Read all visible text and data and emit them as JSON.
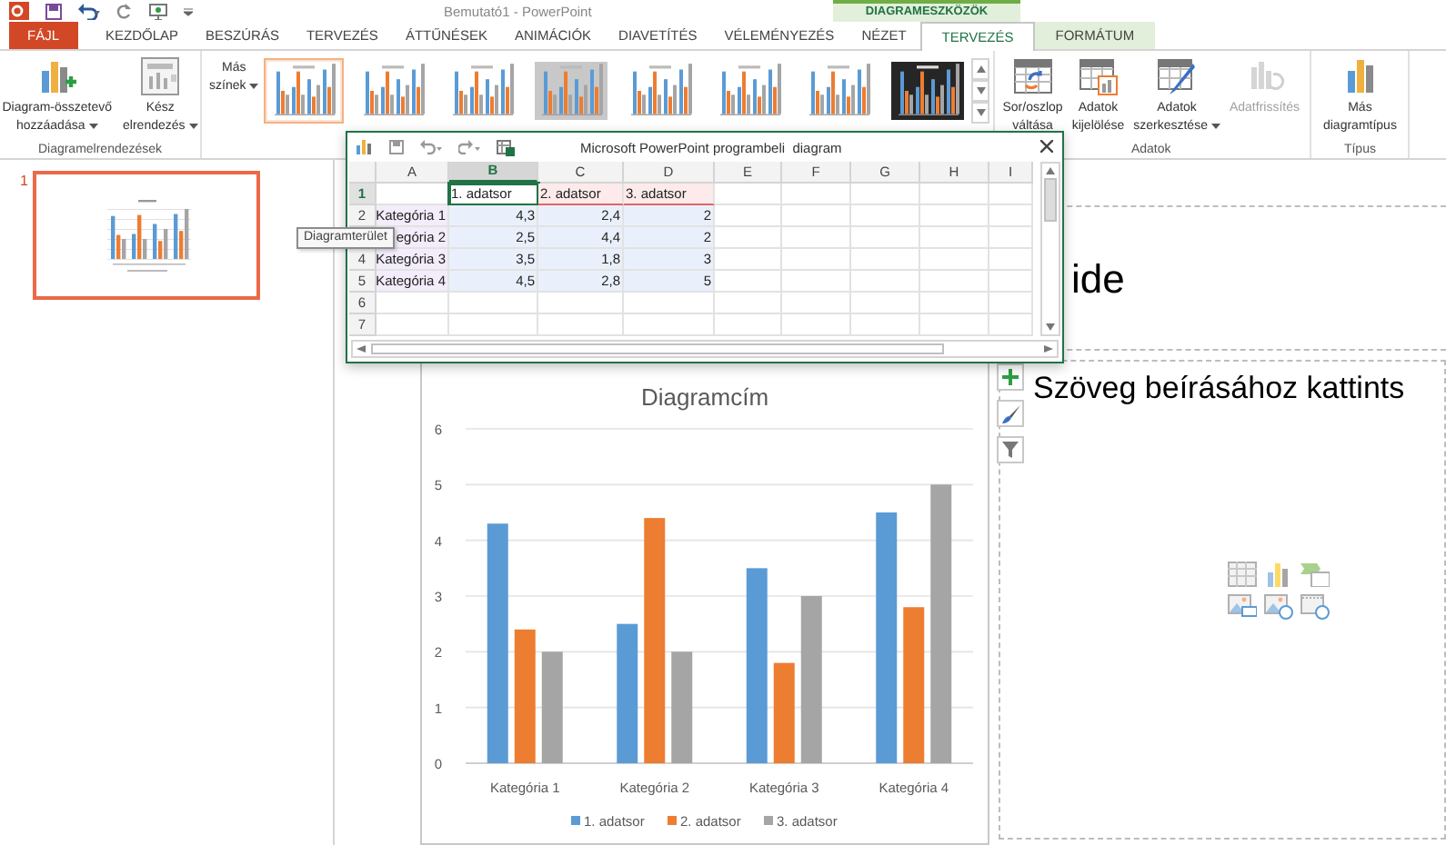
{
  "window": {
    "title": "Bemutató1 - PowerPoint"
  },
  "contextual_group": "DIAGRAMESZKÖZÖK",
  "tabs": [
    {
      "label": "FÁJL",
      "kind": "file",
      "selected": false
    },
    {
      "label": "KEZDŐLAP",
      "kind": "normal",
      "selected": false
    },
    {
      "label": "BESZÚRÁS",
      "kind": "normal",
      "selected": false
    },
    {
      "label": "TERVEZÉS",
      "kind": "normal",
      "selected": false
    },
    {
      "label": "ÁTTŰNÉSEK",
      "kind": "normal",
      "selected": false
    },
    {
      "label": "ANIMÁCIÓK",
      "kind": "normal",
      "selected": false
    },
    {
      "label": "DIAVETÍTÉS",
      "kind": "normal",
      "selected": false
    },
    {
      "label": "VÉLEMÉNYEZÉS",
      "kind": "normal",
      "selected": false
    },
    {
      "label": "NÉZET",
      "kind": "normal",
      "selected": false
    },
    {
      "label": "TERVEZÉS",
      "kind": "contextual",
      "selected": true
    },
    {
      "label": "FORMÁTUM",
      "kind": "contextual",
      "selected": false
    }
  ],
  "layouts_group": {
    "label": "Diagramelrendezések",
    "buttons": [
      {
        "kind": "add",
        "lines": [
          "Diagram-összetevő",
          "hozzáadása"
        ],
        "dropdown": true
      },
      {
        "kind": "layout",
        "lines": [
          "Kész",
          "elrendezés"
        ],
        "dropdown": true
      }
    ]
  },
  "colors_button": {
    "lines": [
      "Más",
      "színek"
    ],
    "dropdown": true
  },
  "chart_styles": [
    {
      "kind": "light",
      "selected": true
    },
    {
      "kind": "light",
      "selected": false
    },
    {
      "kind": "light",
      "selected": false
    },
    {
      "kind": "gray",
      "selected": false
    },
    {
      "kind": "light",
      "selected": false
    },
    {
      "kind": "light",
      "selected": false
    },
    {
      "kind": "light",
      "selected": false
    },
    {
      "kind": "dark",
      "selected": false
    }
  ],
  "data_group": {
    "label": "Adatok",
    "buttons": [
      {
        "kind": "switch",
        "lines": [
          "Sor/oszlop",
          "váltása"
        ],
        "dropdown": false,
        "disabled": false
      },
      {
        "kind": "select",
        "lines": [
          "Adatok",
          "kijelölése"
        ],
        "dropdown": false,
        "disabled": false
      },
      {
        "kind": "edit",
        "lines": [
          "Adatok",
          "szerkesztése"
        ],
        "dropdown": true,
        "disabled": false
      },
      {
        "kind": "refresh",
        "lines": [
          "Adatfrissítés"
        ],
        "dropdown": false,
        "disabled": true
      }
    ]
  },
  "type_group": {
    "label": "Típus",
    "buttons": [
      {
        "kind": "type",
        "lines": [
          "Más",
          "diagramtípus"
        ],
        "dropdown": false,
        "disabled": false
      }
    ]
  },
  "slides": [
    {
      "number": "1",
      "selected": true
    }
  ],
  "tooltip": "Diagramterület",
  "sheet": {
    "title": "Microsoft PowerPoint programbeli  diagram",
    "columns": [
      {
        "label": "A",
        "selected": false
      },
      {
        "label": "B",
        "selected": true
      },
      {
        "label": "C",
        "selected": false
      },
      {
        "label": "D",
        "selected": false
      },
      {
        "label": "E",
        "selected": false
      },
      {
        "label": "F",
        "selected": false
      },
      {
        "label": "G",
        "selected": false
      },
      {
        "label": "H",
        "selected": false
      },
      {
        "label": "I",
        "selected": false
      }
    ],
    "rows": [
      {
        "number": "1",
        "selected": true,
        "kind": "series",
        "values": [
          "1. adatsor",
          "2. adatsor",
          "3. adatsor"
        ]
      },
      {
        "number": "2",
        "selected": false,
        "kind": "data",
        "label": "Kategória 1",
        "values": [
          "4,3",
          "2,4",
          "2"
        ]
      },
      {
        "selected": false,
        "kind": "data",
        "label": "egória 2",
        "values": [
          "2,5",
          "4,4",
          "2"
        ]
      },
      {
        "number": "4",
        "selected": false,
        "kind": "data",
        "label": "Kategória 3",
        "values": [
          "3,5",
          "1,8",
          "3"
        ]
      },
      {
        "number": "5",
        "selected": false,
        "kind": "data",
        "label": "Kategória 4",
        "values": [
          "4,5",
          "2,8",
          "5"
        ]
      },
      {
        "number": "6",
        "selected": false,
        "kind": "empty"
      },
      {
        "number": "7",
        "selected": false,
        "kind": "empty"
      }
    ]
  },
  "slide": {
    "title_placeholder": "ide",
    "content_placeholder": "Szöveg beírásához kattints",
    "chart_data": {
      "type": "bar",
      "title": "Diagramcím",
      "categories": [
        "Kategória 1",
        "Kategória 2",
        "Kategória 3",
        "Kategória 4"
      ],
      "series": [
        {
          "name": "1. adatsor",
          "color": "#5b9bd5",
          "values": [
            4.3,
            2.5,
            3.5,
            4.5
          ]
        },
        {
          "name": "2. adatsor",
          "color": "#ed7d31",
          "values": [
            2.4,
            4.4,
            1.8,
            2.8
          ]
        },
        {
          "name": "3. adatsor",
          "color": "#a5a5a5",
          "values": [
            2,
            2,
            3,
            5
          ]
        }
      ],
      "ylim": [
        0,
        6
      ],
      "yticks": [
        0,
        1,
        2,
        3,
        4,
        5,
        6
      ],
      "grid": true,
      "legend": true
    }
  }
}
